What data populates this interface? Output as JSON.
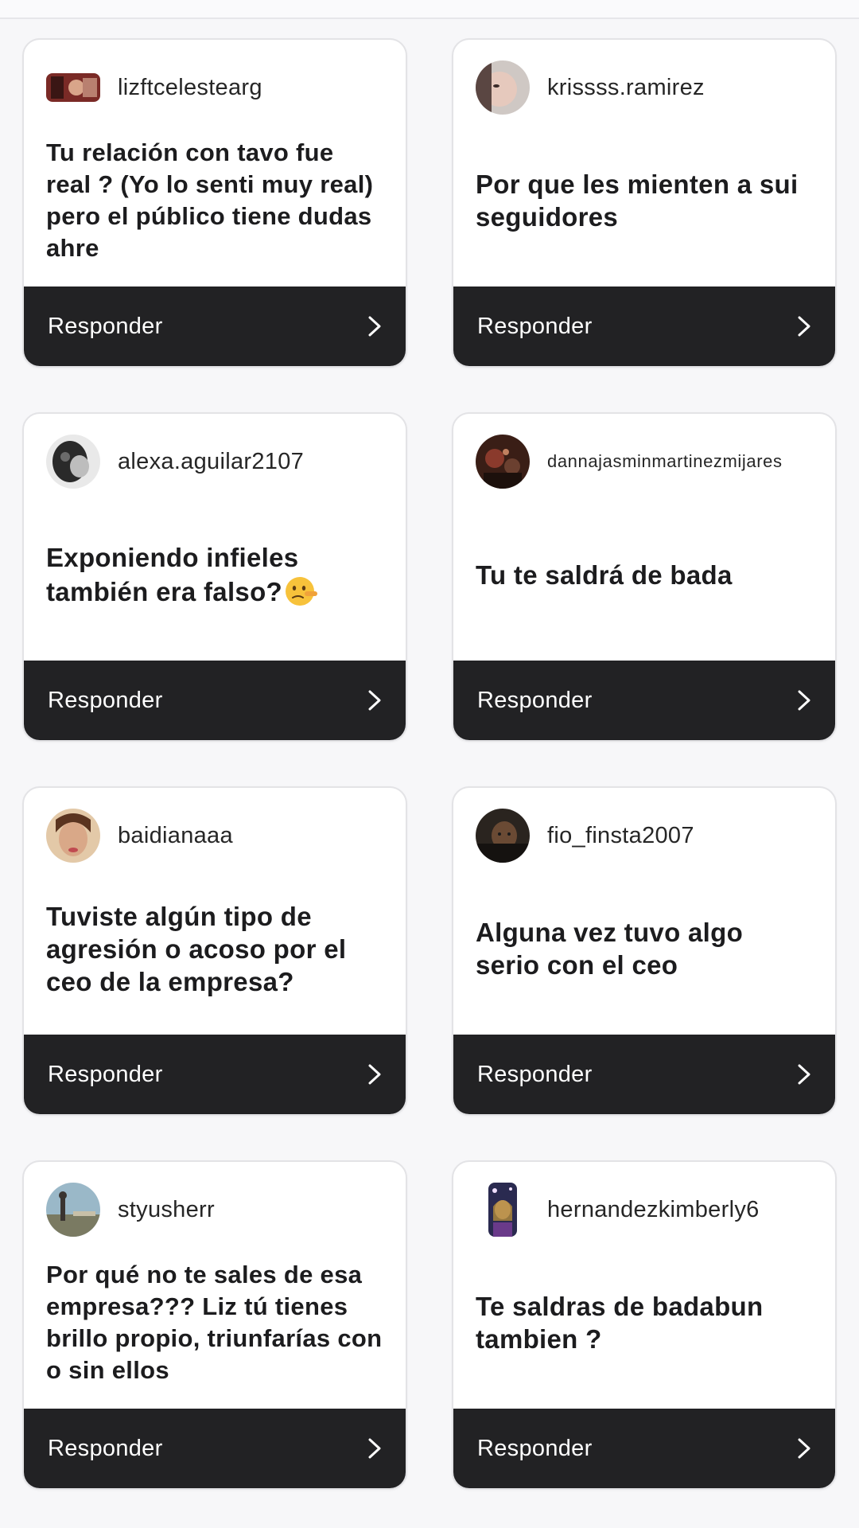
{
  "cards": [
    {
      "username": "lizftcelestearg",
      "question": "Tu relación con tavo fue real ? (Yo lo senti muy real) pero el público tiene dudas ahre",
      "reply_label": "Responder"
    },
    {
      "username": "krissss.ramirez",
      "question": "Por que les mienten a sui seguidores",
      "reply_label": "Responder"
    },
    {
      "username": "alexa.aguilar2107",
      "question": "Exponiendo infieles también era falso?",
      "emoji": "lying-face-icon",
      "reply_label": "Responder"
    },
    {
      "username": "dannajasminmartinezmijares",
      "question": "Tu te saldrá de bada",
      "reply_label": "Responder"
    },
    {
      "username": "baidianaaa",
      "question": "Tuviste algún tipo de agresión o acoso por el ceo de la empresa?",
      "reply_label": "Responder"
    },
    {
      "username": "fio_finsta2007",
      "question": "Alguna vez tuvo algo serio con el ceo",
      "reply_label": "Responder"
    },
    {
      "username": "styusherr",
      "question": "Por qué no te sales de esa empresa??? Liz tú tienes brillo propio, triunfarías con o sin ellos",
      "reply_label": "Responder"
    },
    {
      "username": "hernandezkimberly6",
      "question": "Te saldras de badabun tambien ?",
      "reply_label": "Responder"
    }
  ],
  "colors": {
    "card_background": "#ffffff",
    "reply_bar": "#222224",
    "page_background": "#f7f7f9"
  },
  "icons": {
    "reply_chevron": "chevron-right-icon"
  }
}
